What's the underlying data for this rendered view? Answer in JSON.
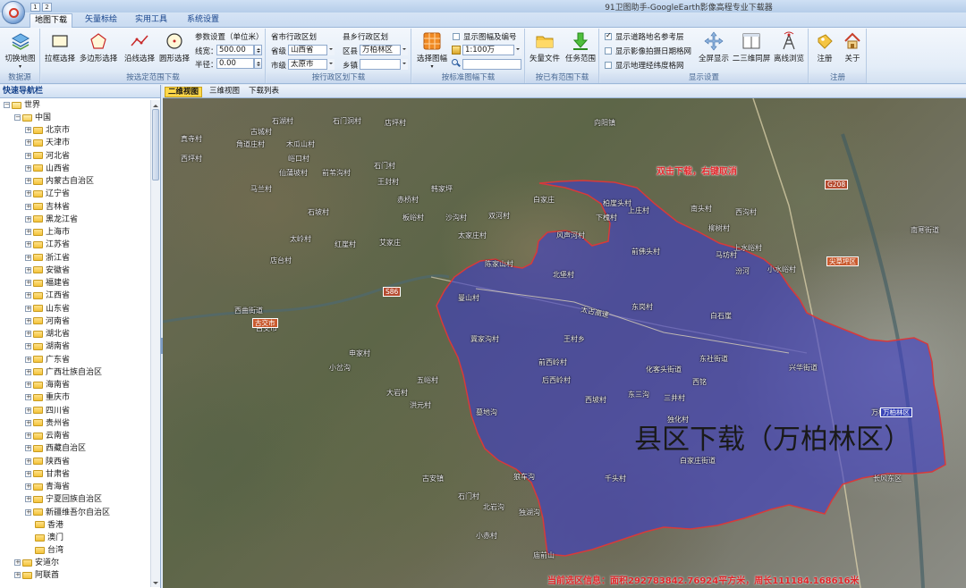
{
  "app": {
    "title": "91卫图助手-GoogleEarth影像高程专业下载器",
    "qat": [
      "1",
      "2"
    ]
  },
  "tabs": [
    {
      "label": "地图下载",
      "active": true
    },
    {
      "label": "矢量标绘",
      "active": false
    },
    {
      "label": "实用工具",
      "active": false
    },
    {
      "label": "系统设置",
      "active": false
    }
  ],
  "ribbon": {
    "datasource": {
      "button": "切换地图",
      "group": "数据源"
    },
    "range": {
      "group": "按选定范围下载",
      "rect": "拉框选择",
      "polygon": "多边形选择",
      "line": "沿线选择",
      "circle": "圆形选择",
      "params_title": "参数设置（单位米）",
      "linewidth_label": "线宽：",
      "linewidth_value": "500.00",
      "radius_label": "半径：",
      "radius_value": "0.00"
    },
    "province": {
      "group": "按行政区划下载",
      "title": "省市行政区划",
      "prov_label": "省级",
      "prov_value": "山西省",
      "city_label": "市级",
      "city_value": "太原市"
    },
    "county": {
      "title": "县乡行政区划",
      "county_label": "区县",
      "county_value": "万柏林区",
      "town_label": "乡镇",
      "town_value": ""
    },
    "sheet": {
      "group": "按标准图幅下载",
      "button": "选择图幅",
      "show_label": "显示图幅及编号",
      "show_checked": false,
      "scale_value": "1:100万"
    },
    "existing": {
      "group": "按已有范围下载",
      "vector": "矢量文件",
      "task": "任务范围"
    },
    "display": {
      "group": "显示设置",
      "road": "显示道路地名参考层",
      "road_checked": true,
      "date": "显示影像拍摄日期格网",
      "date_checked": false,
      "grid": "显示地理经纬度格网",
      "grid_checked": false,
      "fullscreen": "全屏显示",
      "sync": "二三维同屏",
      "offline": "离线浏览"
    },
    "register": {
      "group": "注册",
      "register": "注册",
      "about": "关于"
    }
  },
  "sidebar": {
    "title": "快速导航栏",
    "root": "世界",
    "country": "中国",
    "provinces": [
      "北京市",
      "天津市",
      "河北省",
      "山西省",
      "内蒙古自治区",
      "辽宁省",
      "吉林省",
      "黑龙江省",
      "上海市",
      "江苏省",
      "浙江省",
      "安徽省",
      "福建省",
      "江西省",
      "山东省",
      "河南省",
      "湖北省",
      "湖南省",
      "广东省",
      "广西壮族自治区",
      "海南省",
      "重庆市",
      "四川省",
      "贵州省",
      "云南省",
      "西藏自治区",
      "陕西省",
      "甘肃省",
      "青海省",
      "宁夏回族自治区",
      "新疆维吾尔自治区",
      "香港",
      "澳门",
      "台湾"
    ],
    "more": [
      "安道尔",
      "阿联酋"
    ]
  },
  "viewtabs": [
    {
      "label": "二维视图",
      "active": true
    },
    {
      "label": "三维视图",
      "active": false
    },
    {
      "label": "下载列表",
      "active": false
    }
  ],
  "map": {
    "hint": "双击下载，右键取消",
    "region_label": "县区下载（万柏林区）",
    "status": "当前选区信息：面积292783842.76924平方米，周长111184.168616米",
    "region_color": "#3c3cc8",
    "region_border": "#d83a3a",
    "places": [
      "石湖村",
      "古城村",
      "石门洞村",
      "店坪村",
      "真寺村",
      "角道庄村",
      "木瓜山村",
      "西坪村",
      "峪口村",
      "前苇沟村",
      "仙蒲坡村",
      "石门村",
      "王封村",
      "马兰村",
      "赤桥村",
      "板峪村",
      "石坡村",
      "太岭村",
      "红崖村",
      "艾家庄",
      "店台村",
      "韩家坪",
      "沙沟村",
      "太家庄村",
      "双河村",
      "向阳镇",
      "陈家山村",
      "下槐村",
      "白家庄",
      "风声河村",
      "柏崖头村",
      "东岗村",
      "曼山村",
      "北堡村",
      "王村乡",
      "冀家沟村",
      "前西岭村",
      "后西岭村",
      "墓地沟",
      "狼车沟",
      "化客头街道",
      "东社街道",
      "兴华街道",
      "万柏林区",
      "白家庄街道",
      "长风东区",
      "千头村",
      "西铭",
      "马坊村",
      "白石崖",
      "汾河",
      "上水峪村",
      "小水峪村",
      "南寒街道",
      "古交市",
      "西曲街道",
      "申家村",
      "小岔沟",
      "大岩村",
      "洪元村",
      "庙前山",
      "石门村",
      "小赤村",
      "北岩沟",
      "独湖沟",
      "古安镇",
      "东三沟",
      "五峪村",
      "西坡村",
      "三井村",
      "独化村",
      "前佛头村",
      "南头村",
      "柳树村",
      "西沟村",
      "上庄村"
    ],
    "roads": [
      "G208",
      "S86",
      "太古高速",
      "尖草坪区",
      "古交市",
      "万柏林区"
    ]
  }
}
